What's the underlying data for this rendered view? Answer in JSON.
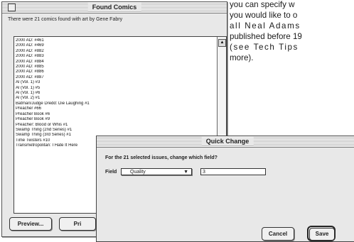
{
  "back_window": {
    "title": "Found Comics",
    "status": "There were 21 comics found with art by Gene Fabry",
    "items": [
      "2000 AD: #461",
      "2000 AD: #469",
      "2000 AD: #882",
      "2000 AD: #883",
      "2000 AD: #884",
      "2000 AD: #885",
      "2000 AD: #886",
      "2000 AD: #887",
      "Al (Vol. 1) #3",
      "Al (Vol. 1) #5",
      "Al (Vol. 1) #6",
      "Al (Vol. 2) #1",
      "Batman/Judge Dredd: Die Laughing #1",
      "Preacher #66",
      "Preacher Book #6",
      "Preacher Book #9",
      "Preacher: Blood or Whis #1",
      "Swamp Thing (2nd Series) #1",
      "Swamp Thing (3rd Series) #1",
      "Time Twisters #10",
      "Transmetropolitan: I Hate It Here"
    ],
    "preview_label": "Preview...",
    "print_label": "Pri"
  },
  "paragraph": {
    "lines": [
      "you can specify w",
      "you would like to o",
      "all  Neal  Adams",
      "published before 19",
      "(see  Tech  Tips",
      "more)."
    ]
  },
  "dialog": {
    "title": "Quick Change",
    "prompt": "For the 21 selected issues, change which field?",
    "field_label": "Field",
    "field_value": "Quality",
    "value": "3",
    "cancel_label": "Cancel",
    "save_label": "Save"
  }
}
